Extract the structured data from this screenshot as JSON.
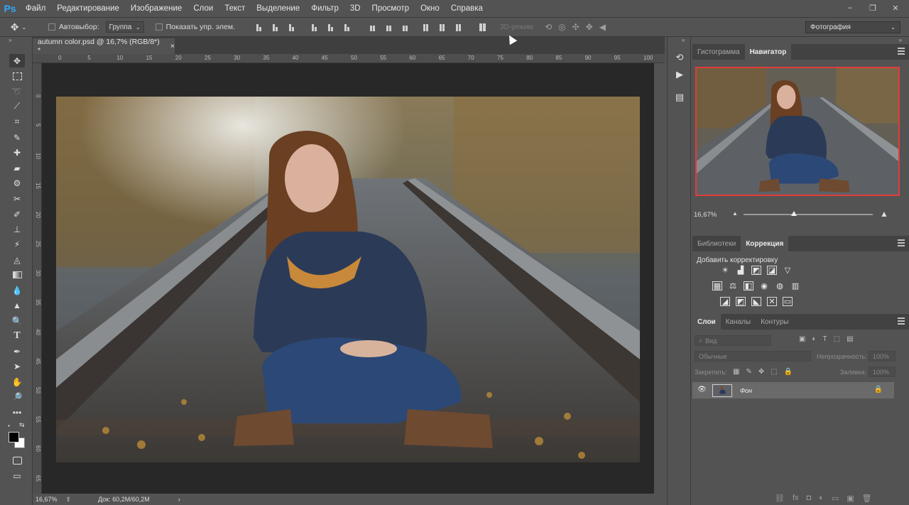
{
  "app": {
    "logo": "Ps"
  },
  "menu": [
    "Файл",
    "Редактирование",
    "Изображение",
    "Слои",
    "Текст",
    "Выделение",
    "Фильтр",
    "3D",
    "Просмотр",
    "Окно",
    "Справка"
  ],
  "window_controls": [
    "–",
    "❐",
    "✕"
  ],
  "options": {
    "autoselect_label": "Автовыбор:",
    "autoselect_value": "Группа",
    "show_controls_label": "Показать упр. элем.",
    "mode3d_label": "3D-режим:",
    "workspace": "Фотография"
  },
  "document": {
    "tab_title": "autumn color.psd @ 16,7% (RGB/8*) *",
    "ruler_x": [
      "0",
      "5",
      "10",
      "15",
      "20",
      "25",
      "30",
      "35",
      "40",
      "45",
      "50",
      "55",
      "60",
      "65",
      "70",
      "75",
      "80",
      "85",
      "90",
      "95",
      "100"
    ],
    "ruler_y": [
      "0",
      "5",
      "1 0",
      "1 5",
      "2 0",
      "2 5",
      "3 0",
      "3 5",
      "4 0",
      "4 5",
      "5 0",
      "5 5",
      "6 0",
      "6 5"
    ],
    "zoom": "16,67%",
    "doc_info": "Док: 60,2M/60,2M"
  },
  "navigator": {
    "tabs": [
      "Гистограмма",
      "Навигатор"
    ],
    "zoom": "16,67%"
  },
  "adjustments": {
    "tabs": [
      "Библиотеки",
      "Коррекция"
    ],
    "title": "Добавить корректировку",
    "row1": [
      "☀",
      "▟",
      "◩",
      "◪",
      "▽"
    ],
    "row2": [
      "▦",
      "⚖",
      "◧",
      "◉",
      "◍",
      "▥"
    ],
    "row3": [
      "◢",
      "◩",
      "◣",
      "✕",
      "▭"
    ]
  },
  "layers": {
    "tabs": [
      "Слои",
      "Каналы",
      "Контуры"
    ],
    "kind_placeholder": "Вид",
    "blend_mode": "Обычные",
    "opacity_label": "Непрозрачность:",
    "opacity_value": "100%",
    "lock_label": "Закрепить:",
    "fill_label": "Заливка:",
    "fill_value": "100%",
    "layer_name": "Фон",
    "bottom_icons": [
      "⛓",
      "fx",
      "◘",
      "◐",
      "▭",
      "▣",
      "🗑"
    ]
  },
  "colors": {
    "accent_red": "#e23b3b",
    "ps_blue": "#31a8ff"
  }
}
